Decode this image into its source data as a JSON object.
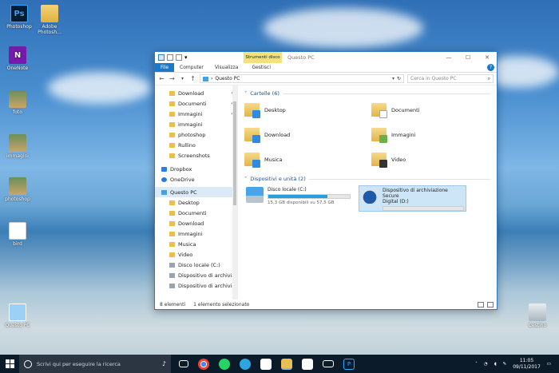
{
  "desktop": {
    "icons": [
      {
        "label": "Photoshop",
        "glyph": "Ps"
      },
      {
        "label": "Adobe Photosh...",
        "glyph": ""
      },
      {
        "label": "OneNote",
        "glyph": "N"
      },
      {
        "label": "foto",
        "glyph": ""
      },
      {
        "label": "immagini",
        "glyph": ""
      },
      {
        "label": "photoshop",
        "glyph": ""
      },
      {
        "label": "bird",
        "glyph": ""
      },
      {
        "label": "Questo PC",
        "glyph": ""
      },
      {
        "label": "Cestino",
        "glyph": ""
      }
    ]
  },
  "window": {
    "context_tab": "Strumenti disco",
    "title": "Questo PC",
    "controls": {
      "minimize": "—",
      "maximize": "☐",
      "close": "✕"
    },
    "ribbon_tabs": [
      "File",
      "Computer",
      "Visualizza",
      "Gestisci"
    ],
    "help": "?",
    "address": {
      "path": "Questo PC",
      "search_placeholder": "Cerca in Questo PC"
    },
    "nav_pane": [
      {
        "label": "Download",
        "type": "folder",
        "pinned": true
      },
      {
        "label": "Documenti",
        "type": "folder",
        "pinned": true
      },
      {
        "label": "Immagini",
        "type": "folder",
        "pinned": true
      },
      {
        "label": "immagini",
        "type": "folder",
        "pinned": false
      },
      {
        "label": "photoshop",
        "type": "folder",
        "pinned": false
      },
      {
        "label": "Rullino",
        "type": "folder",
        "pinned": false
      },
      {
        "label": "Screenshots",
        "type": "folder",
        "pinned": false
      },
      {
        "label": "Dropbox",
        "type": "dropbox",
        "pinned": false
      },
      {
        "label": "OneDrive",
        "type": "onedrive",
        "pinned": false
      },
      {
        "label": "Questo PC",
        "type": "pc",
        "pinned": false,
        "selected": true
      },
      {
        "label": "Desktop",
        "type": "folder",
        "pinned": false
      },
      {
        "label": "Documenti",
        "type": "folder",
        "pinned": false
      },
      {
        "label": "Download",
        "type": "folder",
        "pinned": false
      },
      {
        "label": "Immagini",
        "type": "folder",
        "pinned": false
      },
      {
        "label": "Musica",
        "type": "folder",
        "pinned": false
      },
      {
        "label": "Video",
        "type": "folder",
        "pinned": false
      },
      {
        "label": "Disco locale (C:)",
        "type": "disk",
        "pinned": false
      },
      {
        "label": "Dispositivo di archiviaz",
        "type": "disk",
        "pinned": false
      },
      {
        "label": "Dispositivo di archiviazio",
        "type": "disk",
        "pinned": false
      }
    ],
    "folders_header": "Cartelle (6)",
    "folders": [
      {
        "label": "Desktop",
        "overlay": "blue"
      },
      {
        "label": "Documenti",
        "overlay": "doc"
      },
      {
        "label": "Download",
        "overlay": "dl"
      },
      {
        "label": "Immagini",
        "overlay": "green"
      },
      {
        "label": "Musica",
        "overlay": "note"
      },
      {
        "label": "Video",
        "overlay": "film"
      }
    ],
    "drives_header": "Dispositivi e unità (2)",
    "drives": [
      {
        "label": "Disco locale (C:)",
        "label2": "",
        "free": "15,3 GB disponibili su 57,5 GB",
        "used_fraction": 0.73,
        "selected": false
      },
      {
        "label": "Dispositivo di archiviazione Secure",
        "label2": "Digital (D:)",
        "free": "",
        "used_fraction": 0.0,
        "selected": true
      }
    ],
    "status": {
      "count": "8 elementi",
      "selection": "1 elemento selezionato"
    }
  },
  "taskbar": {
    "search_placeholder": "Scrivi qui per eseguire la ricerca",
    "time": "11:05",
    "date": "09/11/2017"
  }
}
